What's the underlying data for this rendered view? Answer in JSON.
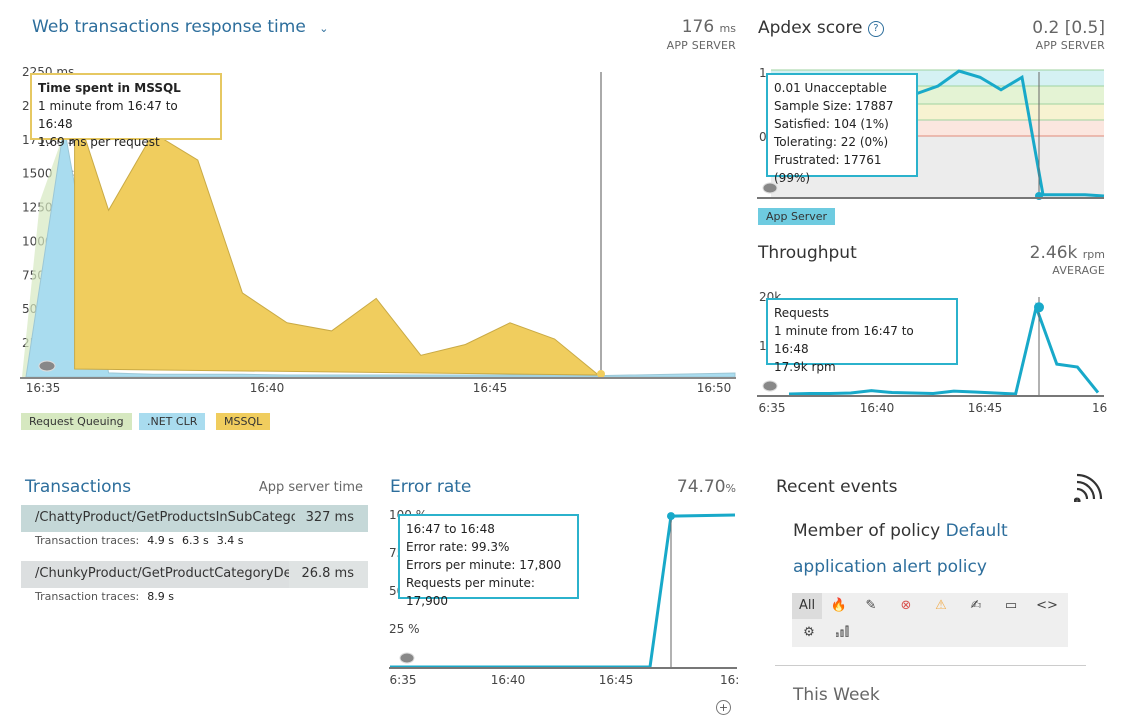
{
  "web": {
    "title": "Web transactions response time",
    "value": "176",
    "unit": "ms",
    "sublabel": "APP SERVER",
    "y_ticks": [
      "2250 ms",
      "2000 ms",
      "1750 ms",
      "1500 ms",
      "1250 ms",
      "1000 ms",
      "750 ms",
      "500 ms",
      "250 ms"
    ],
    "x_ticks": [
      "16:35",
      "16:40",
      "16:45",
      "16:50"
    ],
    "tooltip": {
      "title": "Time spent in MSSQL",
      "line1": "1 minute from 16:47 to 16:48",
      "line2": "1.69 ms per request"
    },
    "legend": [
      "Request Queuing",
      ".NET CLR",
      "MSSQL"
    ]
  },
  "apdex": {
    "title": "Apdex score",
    "value": "0.2 [0.5]",
    "sublabel": "APP SERVER",
    "y_ticks": [
      "1",
      "0"
    ],
    "tooltip": {
      "title": "0.01 Unacceptable",
      "sample": "Sample Size: 17887",
      "satisfied": "Satisfied: 104 (1%)",
      "tolerating": "Tolerating: 22 (0%)",
      "frustrated": "Frustrated: 17761 (99%)"
    },
    "legend": "App Server"
  },
  "throughput": {
    "title": "Throughput",
    "value": "2.46k",
    "unit": "rpm",
    "sublabel": "AVERAGE",
    "y_ticks": [
      "20k",
      "10k"
    ],
    "x_ticks": [
      "6:35",
      "16:40",
      "16:45",
      "16:5"
    ],
    "tooltip": {
      "title": "Requests",
      "line1": "1 minute from 16:47 to 16:48",
      "line2": "17.9k rpm"
    }
  },
  "transactions": {
    "title": "Transactions",
    "sublabel": "App server time",
    "rows": [
      {
        "name": "/ChattyProduct/GetProductsInSubCatego",
        "time": "327 ms",
        "traces_label": "Transaction traces:",
        "traces": [
          "4.9 s",
          "6.3 s",
          "3.4 s"
        ]
      },
      {
        "name": "/ChunkyProduct/GetProductCategoryDet",
        "time": "26.8 ms",
        "traces_label": "Transaction traces:",
        "traces": [
          "8.9 s"
        ]
      }
    ]
  },
  "error_rate": {
    "title": "Error rate",
    "value": "74.70",
    "unit": "%",
    "y_ticks": [
      "100 %",
      "75 %",
      "50 %",
      "25 %"
    ],
    "x_ticks": [
      "6:35",
      "16:40",
      "16:45",
      "16:5"
    ],
    "tooltip": {
      "title": "16:47 to 16:48",
      "rate": "Error rate: 99.3%",
      "errors": "Errors per minute: 17,800",
      "requests": "Requests per minute: 17,900"
    }
  },
  "events": {
    "title": "Recent events",
    "policy_prefix": "Member of policy",
    "policy_link1": "Default",
    "policy_link2": "application alert policy",
    "filter_all": "All",
    "this_week": "This Week"
  },
  "colors": {
    "link": "#2d6e9c",
    "mssql": "#f0cd5e",
    "clr": "#a9dcef",
    "queuing": "#d6e8c0",
    "teal": "#18a9c9",
    "tooltip_mssql_border": "#e6c862",
    "tooltip_teal_border": "#2bb2cc"
  },
  "chart_data": [
    {
      "type": "area",
      "title": "Web transactions response time",
      "ylabel": "ms",
      "ylim": [
        0,
        2250
      ],
      "x": [
        "16:35",
        "16:36",
        "16:37",
        "16:38",
        "16:39",
        "16:40",
        "16:41",
        "16:42",
        "16:43",
        "16:44",
        "16:45",
        "16:46",
        "16:47"
      ],
      "series": [
        {
          "name": "Request Queuing",
          "values": [
            0,
            0,
            0,
            0,
            0,
            0,
            0,
            0,
            0,
            0,
            0,
            0,
            0
          ]
        },
        {
          "name": ".NET CLR",
          "values": [
            1850,
            30,
            20,
            20,
            20,
            15,
            15,
            15,
            15,
            15,
            15,
            15,
            10
          ]
        },
        {
          "name": "MSSQL",
          "values": [
            2000,
            1230,
            1800,
            1600,
            620,
            400,
            340,
            580,
            160,
            240,
            400,
            280,
            10
          ]
        }
      ]
    },
    {
      "type": "line",
      "title": "Apdex score",
      "ylim": [
        0,
        1
      ],
      "x": [
        "16:35",
        "16:36",
        "16:37",
        "16:38",
        "16:39",
        "16:40",
        "16:41",
        "16:42",
        "16:43",
        "16:44",
        "16:45",
        "16:46",
        "16:47",
        "16:48",
        "16:49",
        "16:50"
      ],
      "series": [
        {
          "name": "App Server",
          "values": [
            0.95,
            0.95,
            0.95,
            0.95,
            0.95,
            0.95,
            0.95,
            0.82,
            0.88,
            1.0,
            0.95,
            0.85,
            0.95,
            0.01,
            0.01,
            0.01
          ]
        }
      ]
    },
    {
      "type": "line",
      "title": "Throughput",
      "ylim": [
        0,
        20000
      ],
      "x": [
        "16:36",
        "16:37",
        "16:38",
        "16:39",
        "16:40",
        "16:41",
        "16:42",
        "16:43",
        "16:44",
        "16:45",
        "16:46",
        "16:47",
        "16:48",
        "16:49",
        "16:50",
        "16:51"
      ],
      "series": [
        {
          "name": "Requests",
          "values": [
            200,
            300,
            300,
            400,
            900,
            500,
            400,
            300,
            800,
            600,
            400,
            200,
            17900,
            6300,
            5700,
            500
          ]
        }
      ]
    },
    {
      "type": "line",
      "title": "Error rate",
      "ylim": [
        0,
        100
      ],
      "x": [
        "16:35",
        "16:40",
        "16:45",
        "16:46",
        "16:47",
        "16:48",
        "16:50",
        "16:51"
      ],
      "series": [
        {
          "name": "Error rate",
          "values": [
            0,
            0,
            0,
            0,
            0,
            99.3,
            100,
            100
          ]
        }
      ]
    }
  ]
}
